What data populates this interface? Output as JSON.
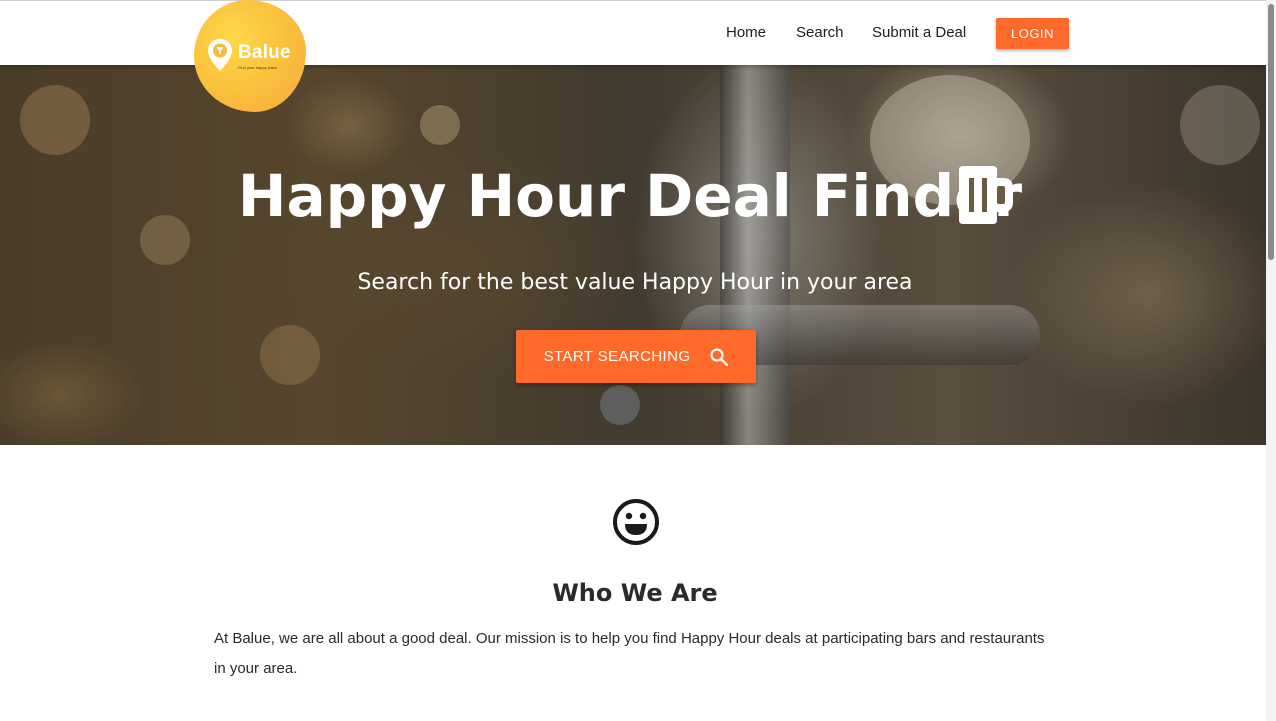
{
  "logo": {
    "brand": "Balue",
    "tagline": "Find your happy place"
  },
  "nav": {
    "items": [
      {
        "label": "Home"
      },
      {
        "label": "Search"
      },
      {
        "label": "Submit a Deal"
      }
    ],
    "login_label": "LOGIN"
  },
  "hero": {
    "title": "Happy Hour Deal Finder",
    "subtitle": "Search for the best value Happy Hour in your area",
    "cta_label": "START SEARCHING",
    "cta_icon": "search-icon",
    "title_icon": "beer-mug-icon"
  },
  "about": {
    "icon": "smiley-face-icon",
    "title": "Who We Are",
    "body": "At Balue, we are all about a good deal. Our mission is to help you find Happy Hour deals at participating bars and restaurants in your area."
  },
  "colors": {
    "accent": "#ff6a2b",
    "logo_gradient_start": "#ffd84a",
    "logo_gradient_end": "#f7a83e",
    "text_dark": "#222222"
  }
}
